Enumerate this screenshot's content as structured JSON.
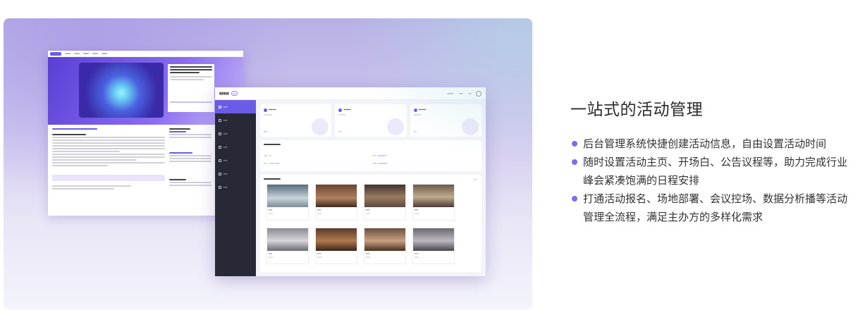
{
  "section": {
    "title": "一站式的活动管理",
    "features": [
      "后台管理系统快捷创建活动信息，自由设置活动时间",
      "随时设置活动主页、开场白、公告议程等，助力完成行业峰会紧凑饱满的日程安排",
      "打通活动报名、场地部署、会议控场、数据分析播等活动管理全流程，满足主办方的多样化需求"
    ]
  },
  "colors": {
    "accent": "#7b6cf0",
    "admin_sidebar": "#272a36",
    "stage_top": "#b8b0e6"
  },
  "icons": {
    "bullet": "dot-icon",
    "avatar": "user-circle-icon"
  }
}
